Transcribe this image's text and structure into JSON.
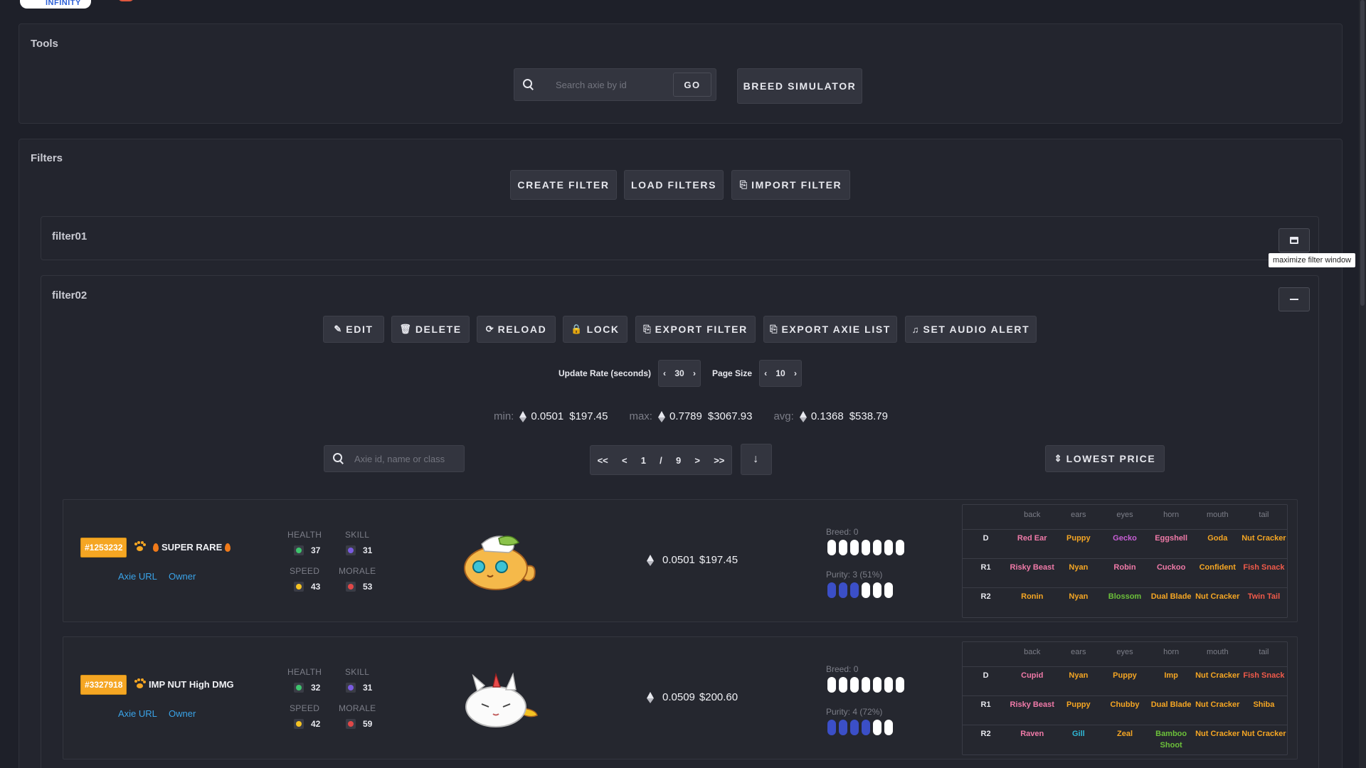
{
  "logo": {
    "word": "INFINITY"
  },
  "tools": {
    "title": "Tools",
    "search_placeholder": "Search axie by id",
    "go_label": "GO",
    "breed_label": "BREED SIMULATOR"
  },
  "filters": {
    "title": "Filters",
    "create_label": "CREATE FILTER",
    "load_label": "LOAD FILTERS",
    "import_label": "IMPORT FILTER",
    "filter1": {
      "name": "filter01",
      "tooltip": "maximize filter window"
    },
    "filter2": {
      "name": "filter02",
      "actions": {
        "edit": "EDIT",
        "delete": "DELETE",
        "reload": "RELOAD",
        "lock": "LOCK",
        "export_filter": "EXPORT FILTER",
        "export_list": "EXPORT AXIE LIST",
        "audio": "SET AUDIO ALERT"
      },
      "update_rate_label": "Update Rate (seconds)",
      "update_rate": "30",
      "page_size_label": "Page Size",
      "page_size": "10",
      "stats": {
        "min_label": "min:",
        "min_eth": "0.0501",
        "min_usd": "$197.45",
        "max_label": "max:",
        "max_eth": "0.7789",
        "max_usd": "$3067.93",
        "avg_label": "avg:",
        "avg_eth": "0.1368",
        "avg_usd": "$538.79"
      },
      "list_search_placeholder": "Axie id, name or class",
      "pager": {
        "first": "<<",
        "prev": "<",
        "page": "1",
        "sep": "/",
        "total": "9",
        "next": ">",
        "last": ">>"
      },
      "sort_label": "LOWEST PRICE"
    }
  },
  "labels": {
    "health": "HEALTH",
    "skill": "SKILL",
    "speed": "SPEED",
    "morale": "MORALE",
    "axie_url": "Axie URL",
    "owner": "Owner",
    "gene_cols": [
      "back",
      "ears",
      "eyes",
      "horn",
      "mouth",
      "tail"
    ]
  },
  "axies": [
    {
      "id": "#1253232",
      "tag": "SUPER RARE",
      "health": "37",
      "skill": "31",
      "speed": "43",
      "morale": "53",
      "price_eth": "0.0501",
      "price_usd": "$197.45",
      "breed_label": "Breed: 0",
      "breed_count": 0,
      "purity_label": "Purity: 3 (51%)",
      "purity_count": 3,
      "genes": [
        {
          "rank": "D",
          "parts": [
            "Red Ear",
            "Puppy",
            "Gecko",
            "Eggshell",
            "Goda",
            "Nut Cracker"
          ],
          "classes": [
            "bird",
            "beast",
            "reptile",
            "bird",
            "beast",
            "beast"
          ]
        },
        {
          "rank": "R1",
          "parts": [
            "Risky Beast",
            "Nyan",
            "Robin",
            "Cuckoo",
            "Confident",
            "Fish Snack"
          ],
          "classes": [
            "bird",
            "beast",
            "bird",
            "bird",
            "beast",
            "bug"
          ]
        },
        {
          "rank": "R2",
          "parts": [
            "Ronin",
            "Nyan",
            "Blossom",
            "Dual Blade",
            "Nut Cracker",
            "Twin Tail"
          ],
          "classes": [
            "beast",
            "beast",
            "plant",
            "beast",
            "beast",
            "bug"
          ]
        }
      ]
    },
    {
      "id": "#3327918",
      "tag": "IMP NUT High DMG",
      "health": "32",
      "skill": "31",
      "speed": "42",
      "morale": "59",
      "price_eth": "0.0509",
      "price_usd": "$200.60",
      "breed_label": "Breed: 0",
      "breed_count": 0,
      "purity_label": "Purity: 4 (72%)",
      "purity_count": 4,
      "genes": [
        {
          "rank": "D",
          "parts": [
            "Cupid",
            "Nyan",
            "Puppy",
            "Imp",
            "Nut Cracker",
            "Fish Snack"
          ],
          "classes": [
            "bird",
            "beast",
            "beast",
            "beast",
            "beast",
            "bug"
          ]
        },
        {
          "rank": "R1",
          "parts": [
            "Risky Beast",
            "Puppy",
            "Chubby",
            "Dual Blade",
            "Nut Cracker",
            "Shiba"
          ],
          "classes": [
            "bird",
            "beast",
            "beast",
            "beast",
            "beast",
            "beast"
          ]
        },
        {
          "rank": "R2",
          "parts": [
            "Raven",
            "Gill",
            "Zeal",
            "Bamboo Shoot",
            "Nut Cracker",
            "Nut Cracker"
          ],
          "classes": [
            "bird",
            "aqua",
            "beast",
            "plant",
            "beast",
            "beast"
          ]
        }
      ]
    }
  ],
  "colors": {
    "beast": "#f5a623",
    "bird": "#f07aa8",
    "bug": "#f05a4a",
    "plant": "#6cc03a",
    "aqua": "#2fb8d6",
    "reptile": "#c95fd6"
  }
}
